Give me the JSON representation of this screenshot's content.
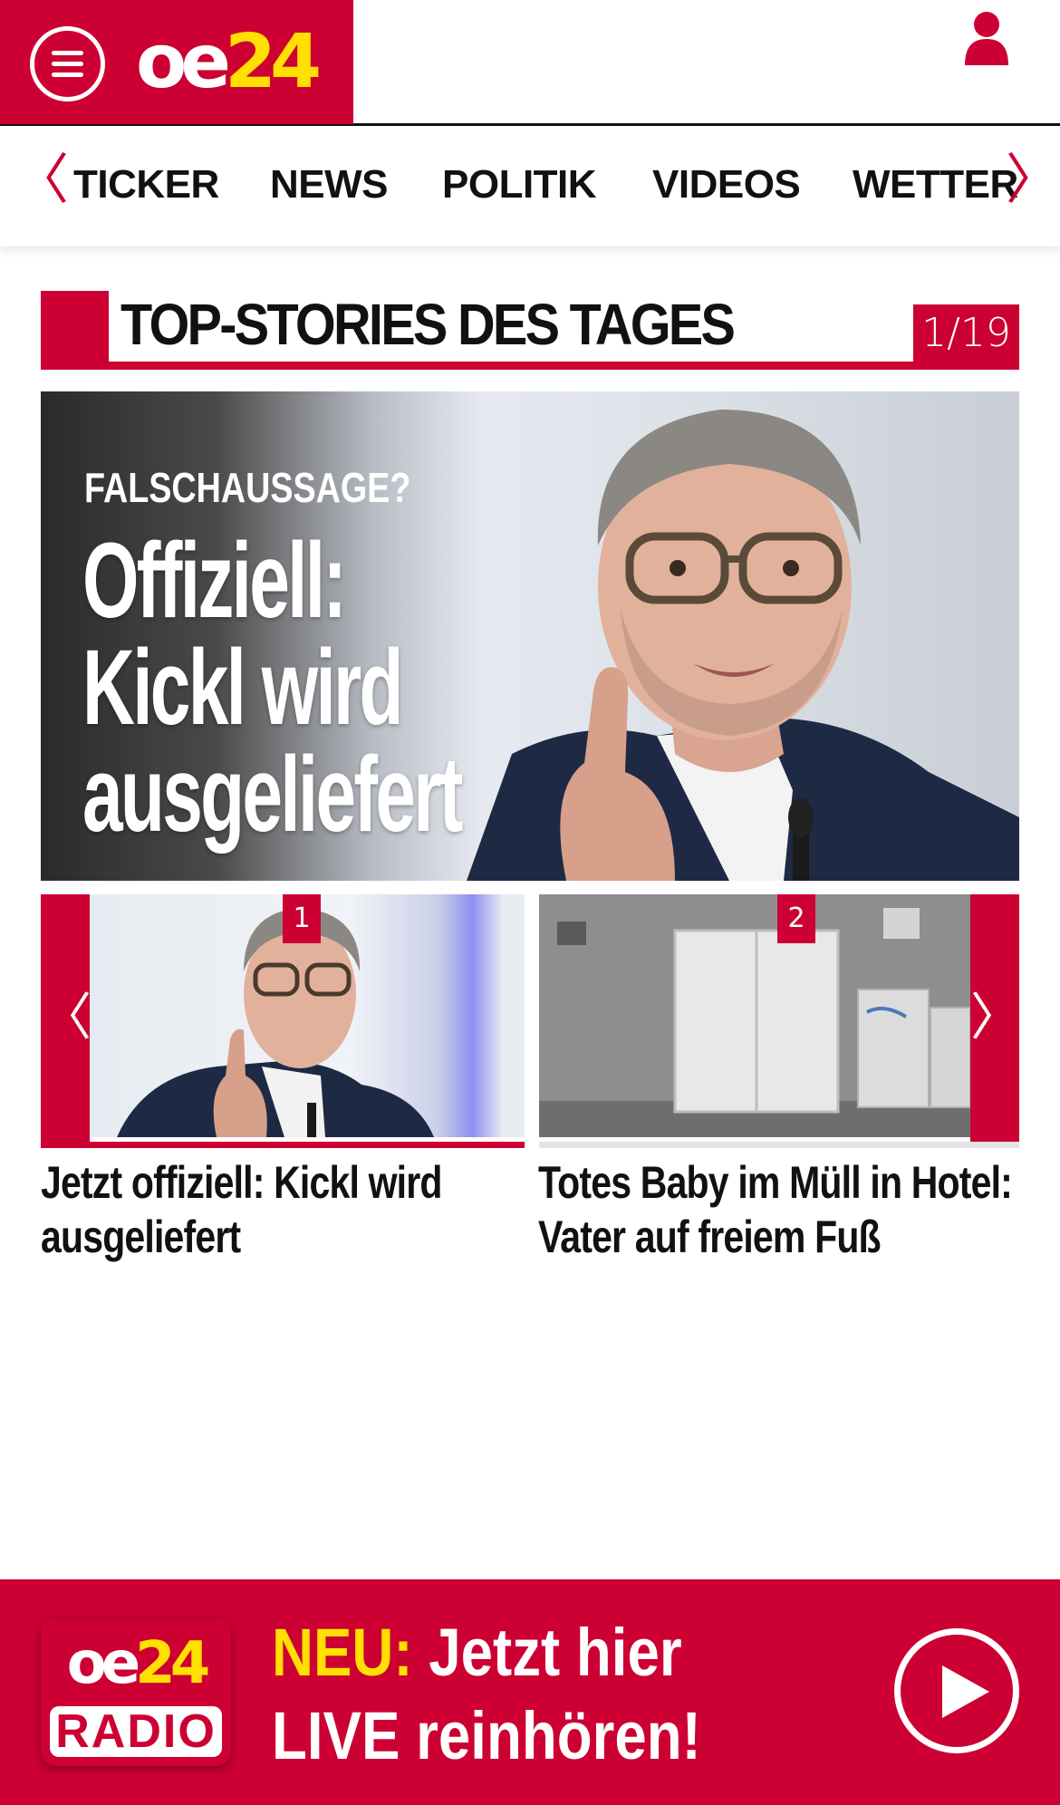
{
  "header": {
    "logo": {
      "part1": "oe",
      "part2": "24"
    },
    "menu_icon": "hamburger-menu-icon",
    "user_icon": "user-icon"
  },
  "nav": {
    "items": [
      {
        "label": "TICKER"
      },
      {
        "label": "NEWS"
      },
      {
        "label": "POLITIK"
      },
      {
        "label": "VIDEOS"
      },
      {
        "label": "WETTER"
      }
    ],
    "left_arrow": "〈",
    "right_arrow": "〉"
  },
  "section": {
    "title": "TOP-STORIES DES TAGES",
    "counter": "1/19"
  },
  "hero": {
    "kicker": "FALSCHAUSSAGE?",
    "headline_line1": "Offiziell:",
    "headline_line2": "Kickl wird",
    "headline_line3": "ausgeliefert"
  },
  "thumbnails": [
    {
      "number": "1",
      "caption": "Jetzt offiziell: Kickl wird ausgeliefert",
      "active": true
    },
    {
      "number": "2",
      "caption": "Totes Baby im Müll in Hotel: Vater auf freiem Fuß",
      "active": false
    }
  ],
  "thumb_arrows": {
    "left": "〈",
    "right": "〉"
  },
  "banner": {
    "logo_top_part1": "oe",
    "logo_top_part2": "24",
    "logo_bottom": "RADIO",
    "highlight": "NEU:",
    "line1_rest": " Jetzt hier",
    "line2": "LIVE reinhören!"
  },
  "colors": {
    "brand_red": "#cc0033",
    "brand_yellow": "#ffe000"
  }
}
